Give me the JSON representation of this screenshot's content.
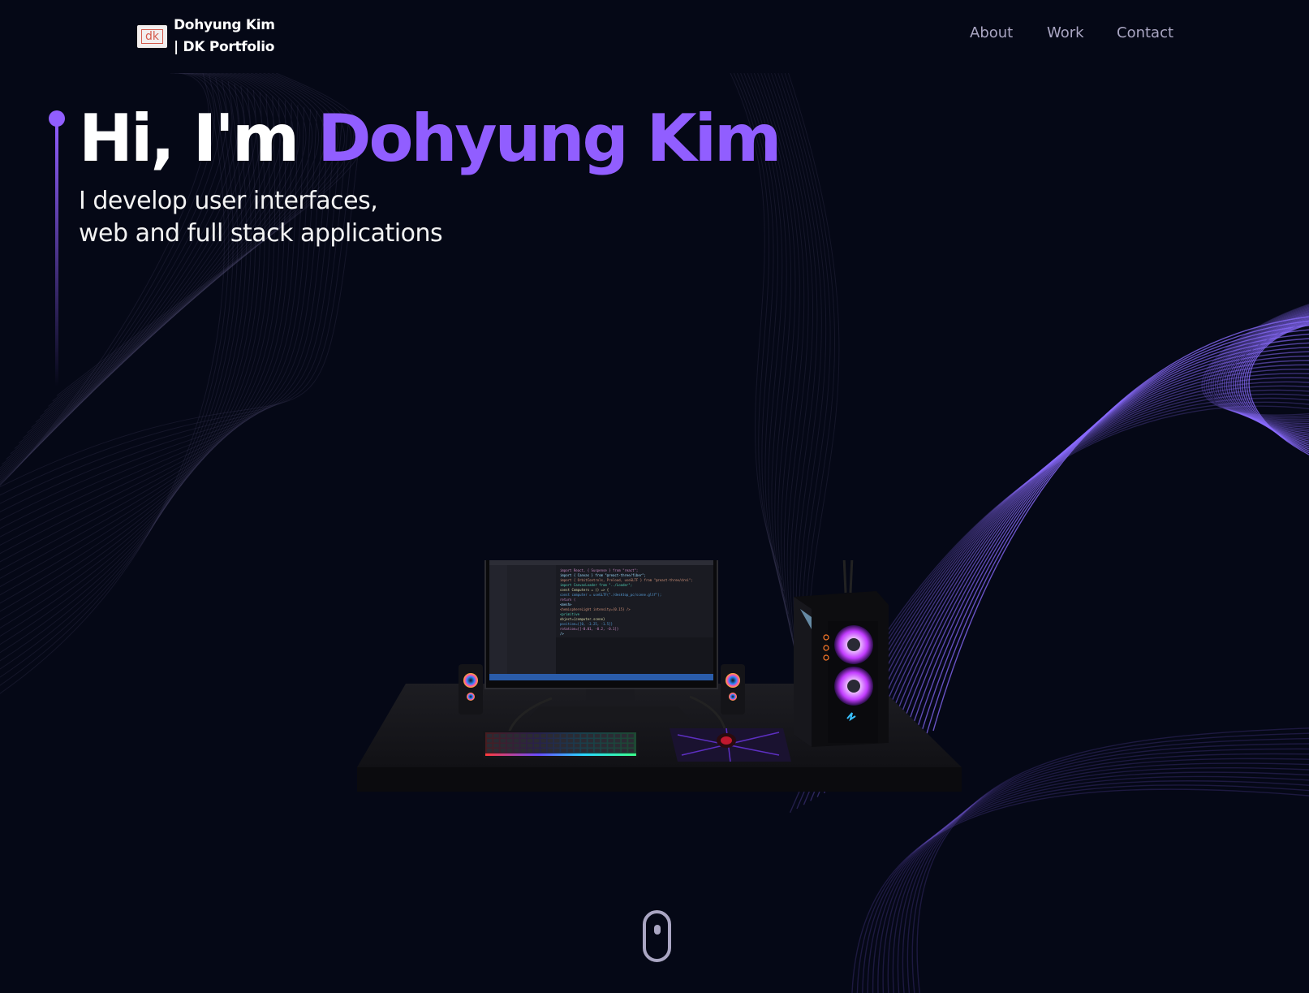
{
  "brand": {
    "logo_text": "dk",
    "name_line1": "Dohyung Kim",
    "name_line2": "| DK Portfolio"
  },
  "nav": {
    "items": [
      {
        "label": "About"
      },
      {
        "label": "Work"
      },
      {
        "label": "Contact"
      }
    ]
  },
  "hero": {
    "greeting": "Hi, I'm ",
    "name": "Dohyung Kim",
    "subtitle_line1": "I develop user interfaces,",
    "subtitle_line2": "web and full stack applications"
  },
  "scene": {
    "code_lines": [
      "import React, { Suspense } from \"react\";",
      "import { Canvas } from \"@react-three/fiber\";",
      "import { OrbitControls, Preload, useGLTF } from \"@react-three/drei\";",
      "import CanvasLoader from \"../Loader\";",
      "const Computers = () => {",
      "  const computer = useGLTF(\"./desktop_pc/scene.gltf\");",
      "  return (",
      "    <mesh>",
      "      <hemisphereLight intensity={0.15} />",
      "      <primitive",
      "        object={computer.scene}",
      "        position={[0, -3.25, -1.5]}",
      "        rotation={[-0.01, -0.2, -0.1]}",
      "      />"
    ]
  },
  "colors": {
    "background": "#050816",
    "accent": "#915eff",
    "nav_text": "#aaa6c3",
    "text": "#ffffff"
  },
  "icons": {
    "scroll": "mouse-scroll-icon"
  }
}
